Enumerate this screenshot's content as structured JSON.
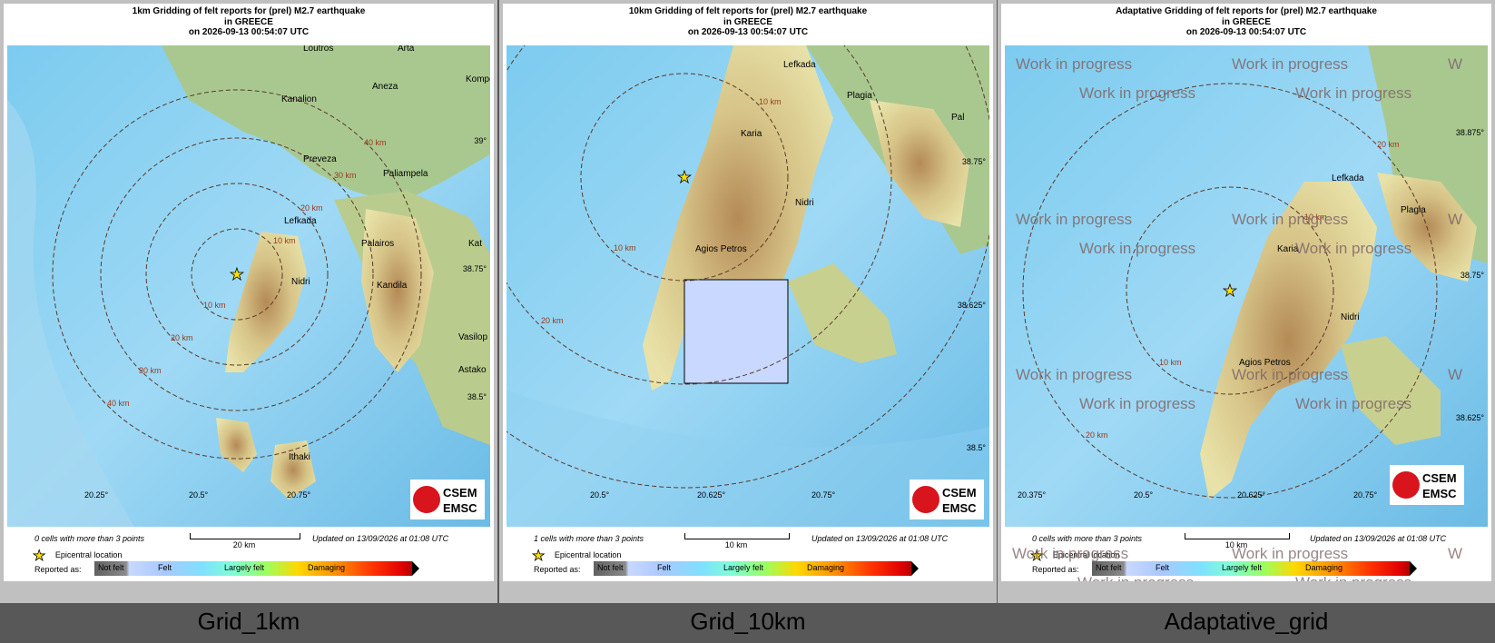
{
  "panels": [
    {
      "title_line1": "1km Gridding of felt reports for (prel) M2.7 earthquake",
      "title_line2": "in GREECE",
      "title_line3": "on 2026-09-13 00:54:07 UTC",
      "cells_text": "0 cells with more than 3 points",
      "scale_text": "20 km",
      "updated_text": "Updated on 13/09/2026 at 01:08 UTC",
      "caption": "Grid_1km",
      "places": [
        "Loutros",
        "Arta",
        "Kanalion",
        "Aneza",
        "Kompo",
        "Preveza",
        "Paliampela",
        "Lefkada",
        "Palairos",
        "Kat",
        "Nidri",
        "Kandila",
        "Vasilop",
        "Astako",
        "Ithaki"
      ],
      "rings": [
        "40 km",
        "30 km",
        "20 km",
        "10 km",
        "10 km",
        "20 km",
        "30 km",
        "40 km"
      ],
      "lon_ticks": [
        "20.25°",
        "20.5°",
        "20.75°"
      ],
      "lat_ticks": [
        "39°",
        "38.75°",
        "38.5°"
      ],
      "watermarks": []
    },
    {
      "title_line1": "10km Gridding of felt reports for (prel) M2.7 earthquake",
      "title_line2": "in GREECE",
      "title_line3": "on 2026-09-13 00:54:07 UTC",
      "cells_text": "1 cells with more than 3 points",
      "scale_text": "10 km",
      "updated_text": "Updated on 13/09/2026 at 01:08 UTC",
      "caption": "Grid_10km",
      "places": [
        "Lefkada",
        "Plagia",
        "Pal",
        "Karia",
        "Nidri",
        "Agios Petros"
      ],
      "rings": [
        "10 km",
        "10 km",
        "20 km"
      ],
      "lon_ticks": [
        "20.5°",
        "20.625°",
        "20.75°"
      ],
      "lat_ticks": [
        "38.75°",
        "38.625°",
        "38.5°"
      ],
      "watermarks": []
    },
    {
      "title_line1": "Adaptative Gridding of felt reports for (prel) M2.7 earthquake",
      "title_line2": "in GREECE",
      "title_line3": "on 2026-09-13 00:54:07 UTC",
      "cells_text": "0 cells with more than 3 points",
      "scale_text": "10 km",
      "updated_text": "Updated on 13/09/2026 at 01:08 UTC",
      "caption": "Adaptative_grid",
      "places": [
        "Lefkada",
        "Plagia",
        "Karia",
        "Nidri",
        "Agios Petros"
      ],
      "rings": [
        "20 km",
        "10 km",
        "10 km",
        "20 km"
      ],
      "lon_ticks": [
        "20.375°",
        "20.5°",
        "20.625°",
        "20.75°"
      ],
      "lat_ticks": [
        "38.875°",
        "38.75°",
        "38.625°"
      ],
      "watermarks": [
        "Work in progress",
        "Work in progress",
        "Work in progress",
        "Work in progress",
        "Work in progress",
        "Work in progress",
        "Work in progress",
        "Work in progress",
        "Work in progress",
        "Work in progress",
        "Work in progress",
        "Work in progress",
        "Work in progress",
        "Work in progress",
        "Work in progress",
        "Work in progress",
        "W",
        "W",
        "W",
        "W"
      ]
    }
  ],
  "legend": {
    "epicenter_label": "Epicentral location",
    "reported_as": "Reported as:",
    "not_felt": "Not felt",
    "felt": "Felt",
    "largely_felt": "Largely felt",
    "damaging": "Damaging"
  },
  "logo": {
    "line1": "CSEM",
    "line2": "EMSC"
  },
  "colors": {
    "sea_deep": "#6cc0e8",
    "sea_shallow": "#b8e6f8",
    "land_low": "#a8c88c",
    "land_high": "#c9a66b",
    "grid_cell": "#c8d8ff",
    "epicenter": "#ffe000",
    "ring": "#5a3a2a"
  }
}
